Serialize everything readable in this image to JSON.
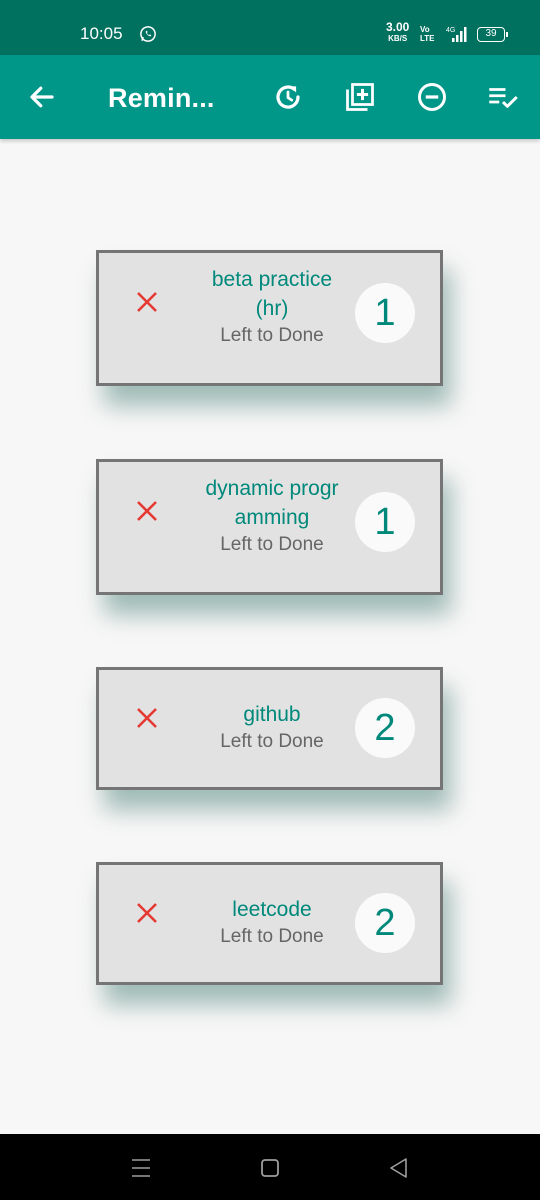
{
  "status_bar": {
    "time": "10:05",
    "net_speed": "3.00",
    "net_unit": "KB/S",
    "volte_top": "Vo",
    "volte_bottom": "LTE",
    "network": "4G",
    "battery": "39"
  },
  "app_bar": {
    "title": "Remin...",
    "icons": [
      "back-arrow-icon",
      "refresh-icon",
      "add-box-icon",
      "remove-circle-icon",
      "playlist-check-icon"
    ]
  },
  "reminders": [
    {
      "name": "beta practice(hr)",
      "subtitle": "Left to Done",
      "count": "1"
    },
    {
      "name": "dynamic programming",
      "subtitle": "Left to Done",
      "count": "1"
    },
    {
      "name": "github",
      "subtitle": "Left to Done",
      "count": "2"
    },
    {
      "name": "leetcode",
      "subtitle": "Left to Done",
      "count": "2"
    }
  ],
  "colors": {
    "status_bar": "#00705f",
    "app_bar": "#009688",
    "accent_text": "#00897b",
    "delete": "#e53935"
  }
}
